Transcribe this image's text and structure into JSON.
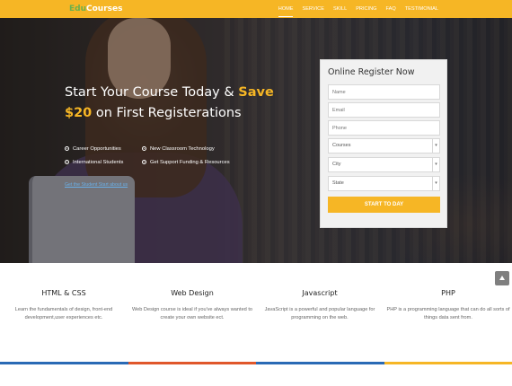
{
  "nav": {
    "logo_prefix": "Edu",
    "logo_suffix": "Courses",
    "items": [
      {
        "label": "HOME",
        "active": true
      },
      {
        "label": "SERVICE"
      },
      {
        "label": "SKILL"
      },
      {
        "label": "PRICING"
      },
      {
        "label": "FAQ"
      },
      {
        "label": "TESTIMONIAL"
      }
    ]
  },
  "hero": {
    "headline_part1": "Start Your Course Today & ",
    "headline_highlight1": "Save",
    "headline_highlight2": "$20",
    "headline_part2": " on First Registerations",
    "features": [
      "Career Opportunities",
      "New Classroom Technology",
      "International Students",
      "Get Support Funding & Resources"
    ],
    "video_link": "Get the Student Start about us"
  },
  "form": {
    "title": "Online Register Now",
    "name_placeholder": "Name",
    "email_placeholder": "Email",
    "phone_placeholder": "Phone",
    "courses_value": "Courses",
    "city_value": "City",
    "state_value": "State",
    "submit_label": "START TO DAY"
  },
  "courses": [
    {
      "title": "HTML & CSS",
      "desc": "Learn the fundamentals of design, front-end development,user experiences etc."
    },
    {
      "title": "Web Design",
      "desc": "Web Design course is ideal if you've always wanted to create your own website ect."
    },
    {
      "title": "Javascript",
      "desc": "JavaScript is a powerful and popular language for programming on the web."
    },
    {
      "title": "PHP",
      "desc": "PHP is a programming language that can do all sorts of things data sent from."
    }
  ],
  "colors": {
    "accent": "#f6b625",
    "logo_green": "#6ab04c",
    "bottom_bar": [
      "#2a6ab5",
      "#e0572b",
      "#2a6ab5",
      "#f6b625"
    ]
  },
  "icons": {
    "feature_bullet": "check-circle-icon",
    "scroll_top": "chevron-up-icon",
    "select_caret": "chevron-down-icon"
  }
}
